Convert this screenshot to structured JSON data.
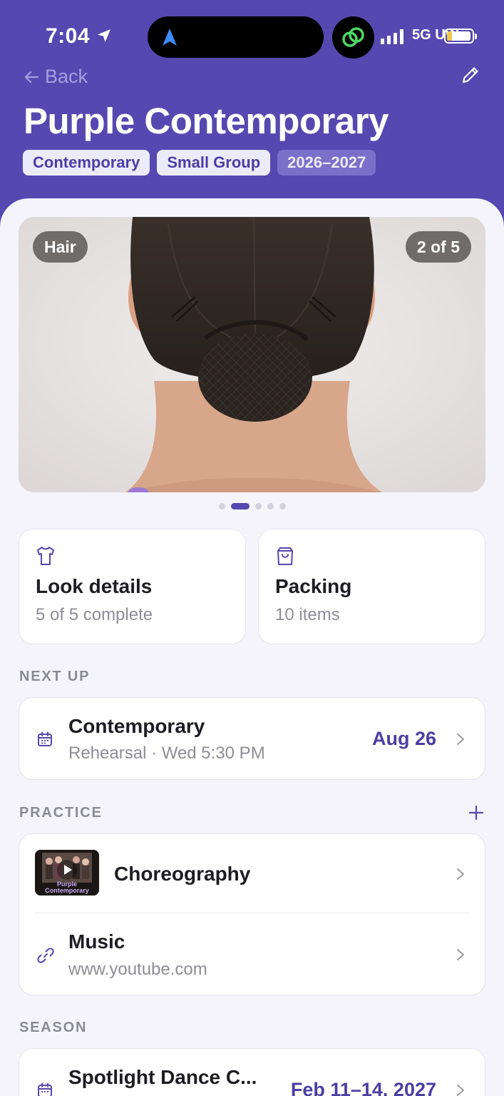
{
  "status_bar": {
    "time": "7:04",
    "network": "5G UW"
  },
  "header": {
    "back_label": "Back",
    "title": "Purple Contemporary",
    "chips": [
      "Contemporary",
      "Small Group",
      "2026–2027"
    ]
  },
  "gallery": {
    "badge": "Hair",
    "counter": "2 of 5",
    "page_index": 2,
    "page_count": 5
  },
  "tiles": {
    "look": {
      "icon": "shirt-icon",
      "title": "Look details",
      "subtitle": "5 of 5 complete"
    },
    "packing": {
      "icon": "bag-icon",
      "title": "Packing",
      "subtitle": "10 items"
    }
  },
  "next_up": {
    "label": "NEXT UP",
    "item": {
      "icon": "calendar-icon",
      "title": "Contemporary",
      "subtitle": "Rehearsal · Wed 5:30 PM",
      "date": "Aug 26"
    }
  },
  "practice": {
    "label": "PRACTICE",
    "items": [
      {
        "icon": "video-thumbnail",
        "thumb_caption": "Purple Contemporary",
        "title": "Choreography"
      },
      {
        "icon": "link-icon",
        "title": "Music",
        "subtitle": "www.youtube.com"
      }
    ]
  },
  "season": {
    "label": "SEASON",
    "item": {
      "icon": "calendar-icon",
      "title": "Spotlight Dance C...",
      "date": "Feb 11–14, 2027"
    }
  },
  "colors": {
    "brand": "#5648b0",
    "accent": "#4a3fa3",
    "background": "#f4f4fa"
  }
}
